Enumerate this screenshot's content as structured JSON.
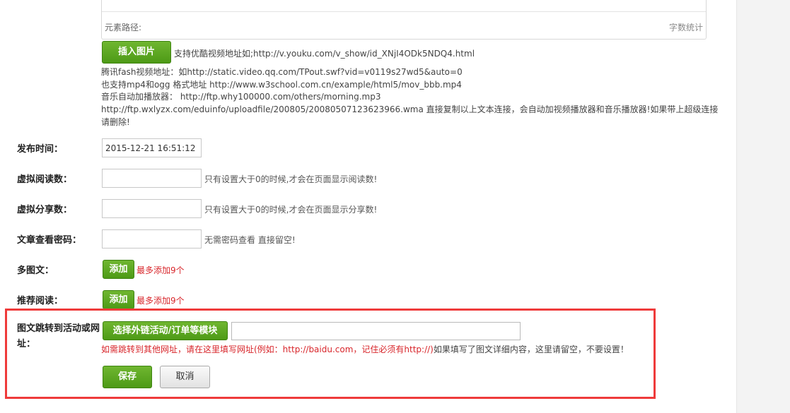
{
  "editor": {
    "element_path_label": "元素路径:",
    "word_count_label": "字数统计"
  },
  "media": {
    "insert_image_button": "插入图片",
    "youku_hint": "支持优酷视频地址如;http://v.youku.com/v_show/id_XNjI4ODk5NDQ4.html",
    "tencent_hint": "腾讯fash视频地址：如http://static.video.qq.com/TPout.swf?vid=v0119s27wd5&auto=0",
    "mp4_hint": "也支持mp4和ogg 格式地址 http://www.w3school.com.cn/example/html5/mov_bbb.mp4",
    "music_hint": "音乐自动加播放器： http://ftp.why100000.com/others/morning.mp3",
    "wma_hint": "http://ftp.wxlyzx.com/eduinfo/uploadfile/200805/20080507123623966.wma 直接复制以上文本连接，会自动加视频播放器和音乐播放器!如果带上超级连接请删除!"
  },
  "form": {
    "publish_time": {
      "label": "发布时间：",
      "value": "2015-12-21 16:51:12"
    },
    "virtual_reads": {
      "label": "虚拟阅读数：",
      "value": "",
      "hint": "只有设置大于0的时候,才会在页面显示阅读数!"
    },
    "virtual_shares": {
      "label": "虚拟分享数：",
      "value": "",
      "hint": "只有设置大于0的时候,才会在页面显示分享数!"
    },
    "view_password": {
      "label": "文章查看密码：",
      "value": "",
      "hint": "无需密码查看 直接留空!"
    },
    "multi_article": {
      "label": "多图文：",
      "add_button": "添加",
      "limit_hint": "最多添加9个"
    },
    "recommended": {
      "label": "推荐阅读：",
      "add_button": "添加",
      "limit_hint": "最多添加9个"
    },
    "redirect": {
      "label": "图文跳转到活动或网址：",
      "select_button": "选择外链活动/订单等模块",
      "value": "",
      "hint_red": "如需跳转到其他网址，请在这里填写网址(例如：http://baidu.com，记住必须有http://)",
      "hint_dark": "如果填写了图文详细内容，这里请留空，不要设置！"
    },
    "save_button": "保存",
    "cancel_button": "取消"
  },
  "colors": {
    "primary_button": "#5aa622",
    "highlight_border": "#ef3b3b",
    "warning_text": "#d8262b"
  }
}
